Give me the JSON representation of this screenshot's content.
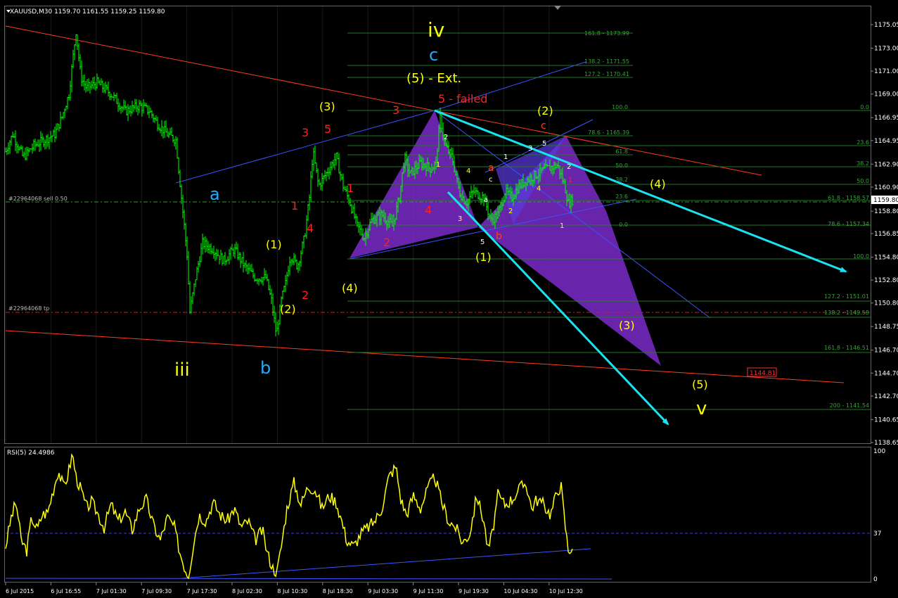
{
  "header": {
    "symbol_info": "XAUUSD,M30  1159.70 1161.55 1159.25 1159.80",
    "indicator_info": "RSI(5) 24.4986"
  },
  "colors": {
    "background": "#000000",
    "grid": "#1a1a1a",
    "candle": "#00ff00",
    "rsi": "#ffff00",
    "trend_red": "#ff3b1f",
    "channel_blue": "#3a53ff",
    "fib": "#1f7a1f",
    "fib_text": "#36a336",
    "arrow": "#19e3f0",
    "pattern_fill": "#7a2bc9"
  },
  "price_axis": {
    "ticks": [
      "1175.05",
      "1173.00",
      "1171.00",
      "1169.00",
      "1166.95",
      "1164.95",
      "1162.90",
      "1160.90",
      "1158.80",
      "1156.85",
      "1154.80",
      "1152.80",
      "1150.80",
      "1148.75",
      "1146.70",
      "1144.70",
      "1142.70",
      "1140.65",
      "1138.65"
    ],
    "current_price": "1159.80",
    "target_box": "1144.81"
  },
  "rsi_axis": {
    "ticks": [
      "100",
      "37",
      "0"
    ]
  },
  "time_axis": {
    "labels": [
      "6 Jul 2015",
      "6 Jul 16:55",
      "7 Jul 01:30",
      "7 Jul 09:30",
      "7 Jul 17:30",
      "8 Jul 02:30",
      "8 Jul 10:30",
      "8 Jul 18:30",
      "9 Jul 03:30",
      "9 Jul 11:30",
      "9 Jul 19:30",
      "10 Jul 04:30",
      "10 Jul 12:30"
    ]
  },
  "order_lines": {
    "sell": "#22964068 sell 0.50",
    "tp": "#22964068 tp"
  },
  "fib_labels": {
    "upper": [
      "161.8 - 1173.99",
      "138.2 - 1171.55",
      "127.2 - 1170.41",
      "100.0",
      "78.6 - 1165.39",
      "61.8",
      "50.0",
      "38.2",
      "23.6",
      "0.0"
    ],
    "right": [
      "0.0",
      "23.6",
      "38.2",
      "50.0",
      "61.8 - 1158.57",
      "78.6 - 1157.34",
      "100.0",
      "127.2 - 1151.01",
      "138.2 - 1149.58",
      "161.8 - 1146.51",
      "200 - 1141.54"
    ]
  },
  "wave_labels": {
    "iv": "iv",
    "c_top": "c",
    "ext": "(5) - Ext.",
    "five_failed": "5 - failed",
    "a_blue": "a",
    "iii": "iii",
    "b_blue": "b",
    "v": "v",
    "y3": "(3)",
    "y1": "(1)",
    "y2": "(2)",
    "y4": "(4)",
    "y1b": "(1)",
    "y2b": "(2)",
    "y4b": "(4)",
    "y3b": "(3)",
    "y5b": "(5)",
    "r3a": "3",
    "r5a": "5",
    "r1a": "1",
    "r1b": "1",
    "r4a": "4",
    "r2a": "2",
    "r3b": "3",
    "r4b": "4",
    "r2b": "2",
    "o_a": "a",
    "o_b": "b",
    "o_c": "c",
    "w_1": "1",
    "w_2": "2",
    "w_3": "3",
    "w_4": "4",
    "w_5": "5",
    "w_c": "c",
    "w_a": "a",
    "w_s1": "1",
    "w_s2": "2",
    "w_s3": "3",
    "w_s4": "4",
    "w_s5": "5",
    "w_e1": "1",
    "w_e2": "2",
    "w_e4": "4",
    "w_f1": "1",
    "w_f2": "2",
    "w_f4": "4",
    "w_f5": "5",
    "w_f3": "3"
  },
  "chart_data": {
    "type": "candlestick",
    "symbol": "XAUUSD",
    "timeframe": "M30",
    "ohlc_last": {
      "open": 1159.7,
      "high": 1161.55,
      "low": 1159.25,
      "close": 1159.8
    },
    "ylim": [
      1138.65,
      1176.0
    ],
    "close_path": [
      [
        0,
        1164.0
      ],
      [
        10,
        1165.5
      ],
      [
        25,
        1163.5
      ],
      [
        40,
        1164.5
      ],
      [
        55,
        1165.0
      ],
      [
        70,
        1165.5
      ],
      [
        80,
        1167.0
      ],
      [
        90,
        1169.0
      ],
      [
        100,
        1174.5
      ],
      [
        107,
        1170.5
      ],
      [
        115,
        1169.5
      ],
      [
        130,
        1170.0
      ],
      [
        150,
        1169.0
      ],
      [
        170,
        1167.5
      ],
      [
        190,
        1168.0
      ],
      [
        205,
        1167.5
      ],
      [
        215,
        1166.5
      ],
      [
        230,
        1165.5
      ],
      [
        242,
        1165.0
      ],
      [
        250,
        1160.0
      ],
      [
        258,
        1155.0
      ],
      [
        262,
        1150.0
      ],
      [
        270,
        1153.0
      ],
      [
        280,
        1156.0
      ],
      [
        295,
        1155.5
      ],
      [
        310,
        1154.5
      ],
      [
        325,
        1155.5
      ],
      [
        340,
        1154.0
      ],
      [
        355,
        1153.0
      ],
      [
        370,
        1153.0
      ],
      [
        378,
        1151.0
      ],
      [
        385,
        1148.0
      ],
      [
        392,
        1151.0
      ],
      [
        398,
        1152.5
      ],
      [
        405,
        1155.0
      ],
      [
        415,
        1154.0
      ],
      [
        425,
        1156.5
      ],
      [
        432,
        1160.0
      ],
      [
        437,
        1164.0
      ],
      [
        445,
        1161.0
      ],
      [
        460,
        1162.5
      ],
      [
        470,
        1163.5
      ],
      [
        480,
        1161.0
      ],
      [
        490,
        1159.5
      ],
      [
        500,
        1157.5
      ],
      [
        510,
        1156.5
      ],
      [
        520,
        1158.0
      ],
      [
        535,
        1158.5
      ],
      [
        550,
        1157.5
      ],
      [
        560,
        1160.0
      ],
      [
        567,
        1163.5
      ],
      [
        575,
        1162.0
      ],
      [
        590,
        1163.0
      ],
      [
        605,
        1162.5
      ],
      [
        612,
        1163.0
      ],
      [
        618,
        1167.0
      ],
      [
        625,
        1164.5
      ],
      [
        635,
        1163.5
      ],
      [
        645,
        1160.5
      ],
      [
        655,
        1159.5
      ],
      [
        665,
        1160.5
      ],
      [
        680,
        1160.0
      ],
      [
        690,
        1158.0
      ],
      [
        700,
        1158.5
      ],
      [
        710,
        1160.5
      ],
      [
        720,
        1160.0
      ],
      [
        730,
        1161.0
      ],
      [
        740,
        1161.5
      ],
      [
        755,
        1162.0
      ],
      [
        770,
        1162.5
      ],
      [
        785,
        1162.8
      ],
      [
        795,
        1161.0
      ],
      [
        800,
        1159.5
      ],
      [
        806,
        1159.8
      ]
    ],
    "rsi": {
      "name": "RSI(5)",
      "last": 24.4986,
      "ylim": [
        0,
        100
      ],
      "levels": [
        37
      ],
      "path": [
        [
          0,
          25
        ],
        [
          8,
          48
        ],
        [
          15,
          60
        ],
        [
          22,
          30
        ],
        [
          30,
          22
        ],
        [
          37,
          48
        ],
        [
          45,
          38
        ],
        [
          52,
          50
        ],
        [
          60,
          52
        ],
        [
          68,
          70
        ],
        [
          75,
          85
        ],
        [
          82,
          72
        ],
        [
          88,
          80
        ],
        [
          95,
          98
        ],
        [
          100,
          80
        ],
        [
          108,
          68
        ],
        [
          115,
          55
        ],
        [
          122,
          60
        ],
        [
          130,
          52
        ],
        [
          140,
          40
        ],
        [
          150,
          58
        ],
        [
          160,
          45
        ],
        [
          170,
          52
        ],
        [
          180,
          38
        ],
        [
          190,
          55
        ],
        [
          200,
          62
        ],
        [
          210,
          42
        ],
        [
          220,
          30
        ],
        [
          230,
          48
        ],
        [
          240,
          40
        ],
        [
          248,
          20
        ],
        [
          255,
          8
        ],
        [
          260,
          2
        ],
        [
          268,
          30
        ],
        [
          275,
          50
        ],
        [
          285,
          45
        ],
        [
          295,
          60
        ],
        [
          305,
          50
        ],
        [
          315,
          45
        ],
        [
          325,
          55
        ],
        [
          335,
          40
        ],
        [
          345,
          45
        ],
        [
          355,
          30
        ],
        [
          365,
          38
        ],
        [
          372,
          20
        ],
        [
          380,
          8
        ],
        [
          386,
          5
        ],
        [
          392,
          25
        ],
        [
          400,
          55
        ],
        [
          410,
          75
        ],
        [
          420,
          58
        ],
        [
          430,
          72
        ],
        [
          440,
          70
        ],
        [
          450,
          55
        ],
        [
          460,
          65
        ],
        [
          470,
          60
        ],
        [
          478,
          45
        ],
        [
          485,
          30
        ],
        [
          495,
          25
        ],
        [
          505,
          35
        ],
        [
          515,
          40
        ],
        [
          525,
          45
        ],
        [
          535,
          55
        ],
        [
          545,
          80
        ],
        [
          555,
          88
        ],
        [
          562,
          62
        ],
        [
          570,
          50
        ],
        [
          580,
          65
        ],
        [
          590,
          55
        ],
        [
          600,
          70
        ],
        [
          610,
          80
        ],
        [
          620,
          60
        ],
        [
          630,
          45
        ],
        [
          640,
          40
        ],
        [
          650,
          28
        ],
        [
          660,
          35
        ],
        [
          670,
          65
        ],
        [
          680,
          45
        ],
        [
          686,
          22
        ],
        [
          692,
          35
        ],
        [
          700,
          65
        ],
        [
          710,
          58
        ],
        [
          720,
          62
        ],
        [
          730,
          70
        ],
        [
          740,
          75
        ],
        [
          748,
          55
        ],
        [
          755,
          62
        ],
        [
          765,
          58
        ],
        [
          775,
          50
        ],
        [
          785,
          70
        ],
        [
          790,
          72
        ],
        [
          795,
          45
        ],
        [
          800,
          22
        ],
        [
          806,
          24.5
        ]
      ]
    }
  }
}
